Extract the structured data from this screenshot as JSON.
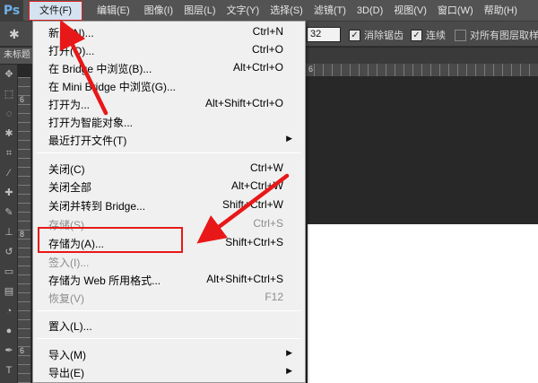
{
  "app": {
    "logo": "Ps"
  },
  "menubar": {
    "items": [
      {
        "label": "文件(F)",
        "active": true
      },
      {
        "label": "编辑(E)"
      },
      {
        "label": "图像(I)"
      },
      {
        "label": "图层(L)"
      },
      {
        "label": "文字(Y)"
      },
      {
        "label": "选择(S)"
      },
      {
        "label": "滤镜(T)"
      },
      {
        "label": "3D(D)"
      },
      {
        "label": "视图(V)"
      },
      {
        "label": "窗口(W)"
      },
      {
        "label": "帮助(H)"
      }
    ]
  },
  "options": {
    "value": "32",
    "antialias": {
      "label": "消除锯齿",
      "checked": true
    },
    "contiguous": {
      "label": "连续",
      "checked": true
    },
    "all_layers": {
      "label": "对所有图层取样",
      "checked": false
    }
  },
  "tabs": {
    "doc": "未标题"
  },
  "ruler": {
    "h_num": "6",
    "v_num_1": "6",
    "v_num_2": "8",
    "v_num_3": "6"
  },
  "file_menu": {
    "items": [
      {
        "label": "新建(N)...",
        "shortcut": "Ctrl+N"
      },
      {
        "label": "打开(O)...",
        "shortcut": "Ctrl+O"
      },
      {
        "label": "在 Bridge 中浏览(B)...",
        "shortcut": "Alt+Ctrl+O"
      },
      {
        "label": "在 Mini Bridge 中浏览(G)...",
        "shortcut": ""
      },
      {
        "label": "打开为...",
        "shortcut": "Alt+Shift+Ctrl+O"
      },
      {
        "label": "打开为智能对象...",
        "shortcut": ""
      },
      {
        "label": "最近打开文件(T)",
        "shortcut": "",
        "submenu": true
      },
      {
        "label": "关闭(C)",
        "shortcut": "Ctrl+W"
      },
      {
        "label": "关闭全部",
        "shortcut": "Alt+Ctrl+W"
      },
      {
        "label": "关闭并转到 Bridge...",
        "shortcut": "Shift+Ctrl+W"
      },
      {
        "label": "存储(S)",
        "shortcut": "Ctrl+S",
        "disabled": true
      },
      {
        "label": "存储为(A)...",
        "shortcut": "Shift+Ctrl+S"
      },
      {
        "label": "签入(I)...",
        "shortcut": "",
        "disabled": true
      },
      {
        "label": "存储为 Web 所用格式...",
        "shortcut": "Alt+Shift+Ctrl+S"
      },
      {
        "label": "恢复(V)",
        "shortcut": "F12",
        "disabled": true
      },
      {
        "label": "置入(L)...",
        "shortcut": ""
      },
      {
        "label": "导入(M)",
        "shortcut": "",
        "submenu": true
      },
      {
        "label": "导出(E)",
        "shortcut": "",
        "submenu": true
      }
    ],
    "submenu_arrow": "▶"
  },
  "annotation": {
    "color": "#e81818"
  }
}
